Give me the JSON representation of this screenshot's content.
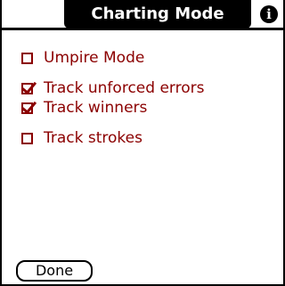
{
  "header": {
    "title": "Charting Mode",
    "info_icon": "info-icon"
  },
  "options": [
    {
      "label": "Umpire Mode",
      "checked": false
    },
    {
      "label": "Track unforced errors",
      "checked": true
    },
    {
      "label": "Track winners",
      "checked": true
    },
    {
      "label": "Track strokes",
      "checked": false
    }
  ],
  "footer": {
    "done_label": "Done"
  },
  "colors": {
    "accent": "#8b0000",
    "title_bg": "#000000",
    "background": "#ffffff"
  }
}
